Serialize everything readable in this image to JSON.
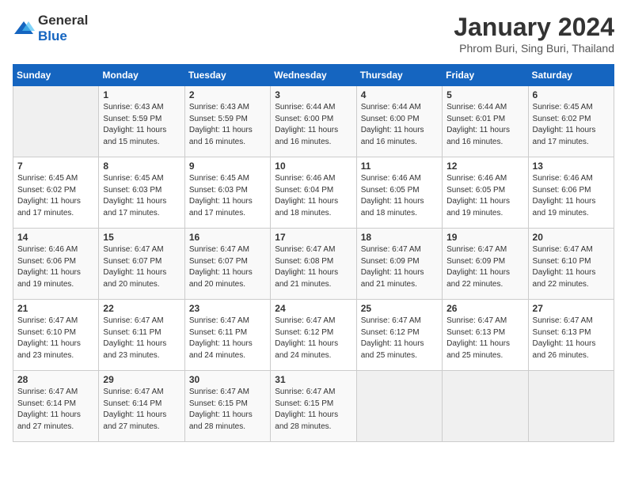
{
  "header": {
    "logo_general": "General",
    "logo_blue": "Blue",
    "month_title": "January 2024",
    "location": "Phrom Buri, Sing Buri, Thailand"
  },
  "calendar": {
    "days_of_week": [
      "Sunday",
      "Monday",
      "Tuesday",
      "Wednesday",
      "Thursday",
      "Friday",
      "Saturday"
    ],
    "weeks": [
      [
        {
          "day": "",
          "info": ""
        },
        {
          "day": "1",
          "info": "Sunrise: 6:43 AM\nSunset: 5:59 PM\nDaylight: 11 hours\nand 15 minutes."
        },
        {
          "day": "2",
          "info": "Sunrise: 6:43 AM\nSunset: 5:59 PM\nDaylight: 11 hours\nand 16 minutes."
        },
        {
          "day": "3",
          "info": "Sunrise: 6:44 AM\nSunset: 6:00 PM\nDaylight: 11 hours\nand 16 minutes."
        },
        {
          "day": "4",
          "info": "Sunrise: 6:44 AM\nSunset: 6:00 PM\nDaylight: 11 hours\nand 16 minutes."
        },
        {
          "day": "5",
          "info": "Sunrise: 6:44 AM\nSunset: 6:01 PM\nDaylight: 11 hours\nand 16 minutes."
        },
        {
          "day": "6",
          "info": "Sunrise: 6:45 AM\nSunset: 6:02 PM\nDaylight: 11 hours\nand 17 minutes."
        }
      ],
      [
        {
          "day": "7",
          "info": "Sunrise: 6:45 AM\nSunset: 6:02 PM\nDaylight: 11 hours\nand 17 minutes."
        },
        {
          "day": "8",
          "info": "Sunrise: 6:45 AM\nSunset: 6:03 PM\nDaylight: 11 hours\nand 17 minutes."
        },
        {
          "day": "9",
          "info": "Sunrise: 6:45 AM\nSunset: 6:03 PM\nDaylight: 11 hours\nand 17 minutes."
        },
        {
          "day": "10",
          "info": "Sunrise: 6:46 AM\nSunset: 6:04 PM\nDaylight: 11 hours\nand 18 minutes."
        },
        {
          "day": "11",
          "info": "Sunrise: 6:46 AM\nSunset: 6:05 PM\nDaylight: 11 hours\nand 18 minutes."
        },
        {
          "day": "12",
          "info": "Sunrise: 6:46 AM\nSunset: 6:05 PM\nDaylight: 11 hours\nand 19 minutes."
        },
        {
          "day": "13",
          "info": "Sunrise: 6:46 AM\nSunset: 6:06 PM\nDaylight: 11 hours\nand 19 minutes."
        }
      ],
      [
        {
          "day": "14",
          "info": "Sunrise: 6:46 AM\nSunset: 6:06 PM\nDaylight: 11 hours\nand 19 minutes."
        },
        {
          "day": "15",
          "info": "Sunrise: 6:47 AM\nSunset: 6:07 PM\nDaylight: 11 hours\nand 20 minutes."
        },
        {
          "day": "16",
          "info": "Sunrise: 6:47 AM\nSunset: 6:07 PM\nDaylight: 11 hours\nand 20 minutes."
        },
        {
          "day": "17",
          "info": "Sunrise: 6:47 AM\nSunset: 6:08 PM\nDaylight: 11 hours\nand 21 minutes."
        },
        {
          "day": "18",
          "info": "Sunrise: 6:47 AM\nSunset: 6:09 PM\nDaylight: 11 hours\nand 21 minutes."
        },
        {
          "day": "19",
          "info": "Sunrise: 6:47 AM\nSunset: 6:09 PM\nDaylight: 11 hours\nand 22 minutes."
        },
        {
          "day": "20",
          "info": "Sunrise: 6:47 AM\nSunset: 6:10 PM\nDaylight: 11 hours\nand 22 minutes."
        }
      ],
      [
        {
          "day": "21",
          "info": "Sunrise: 6:47 AM\nSunset: 6:10 PM\nDaylight: 11 hours\nand 23 minutes."
        },
        {
          "day": "22",
          "info": "Sunrise: 6:47 AM\nSunset: 6:11 PM\nDaylight: 11 hours\nand 23 minutes."
        },
        {
          "day": "23",
          "info": "Sunrise: 6:47 AM\nSunset: 6:11 PM\nDaylight: 11 hours\nand 24 minutes."
        },
        {
          "day": "24",
          "info": "Sunrise: 6:47 AM\nSunset: 6:12 PM\nDaylight: 11 hours\nand 24 minutes."
        },
        {
          "day": "25",
          "info": "Sunrise: 6:47 AM\nSunset: 6:12 PM\nDaylight: 11 hours\nand 25 minutes."
        },
        {
          "day": "26",
          "info": "Sunrise: 6:47 AM\nSunset: 6:13 PM\nDaylight: 11 hours\nand 25 minutes."
        },
        {
          "day": "27",
          "info": "Sunrise: 6:47 AM\nSunset: 6:13 PM\nDaylight: 11 hours\nand 26 minutes."
        }
      ],
      [
        {
          "day": "28",
          "info": "Sunrise: 6:47 AM\nSunset: 6:14 PM\nDaylight: 11 hours\nand 27 minutes."
        },
        {
          "day": "29",
          "info": "Sunrise: 6:47 AM\nSunset: 6:14 PM\nDaylight: 11 hours\nand 27 minutes."
        },
        {
          "day": "30",
          "info": "Sunrise: 6:47 AM\nSunset: 6:15 PM\nDaylight: 11 hours\nand 28 minutes."
        },
        {
          "day": "31",
          "info": "Sunrise: 6:47 AM\nSunset: 6:15 PM\nDaylight: 11 hours\nand 28 minutes."
        },
        {
          "day": "",
          "info": ""
        },
        {
          "day": "",
          "info": ""
        },
        {
          "day": "",
          "info": ""
        }
      ]
    ]
  }
}
